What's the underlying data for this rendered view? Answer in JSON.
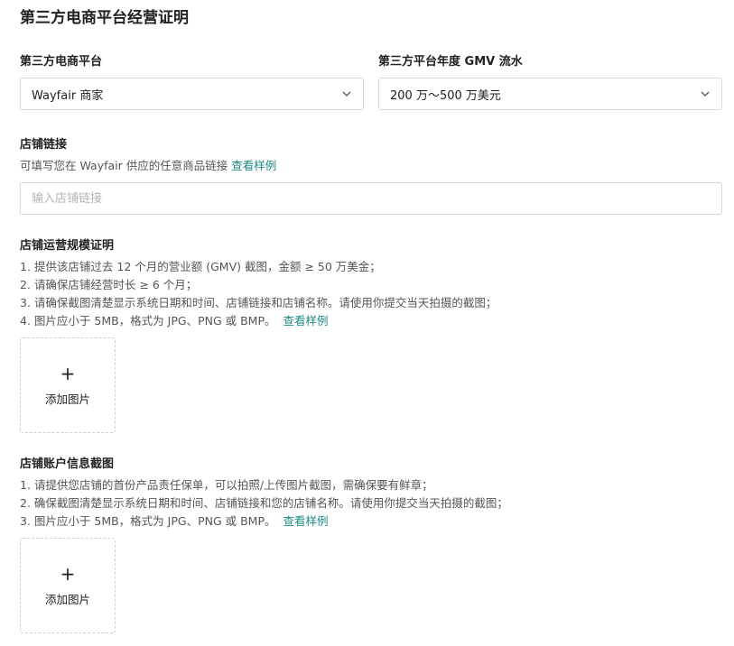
{
  "page": {
    "title": "第三方电商平台经营证明"
  },
  "platform": {
    "label": "第三方电商平台",
    "value": "Wayfair 商家",
    "icon": "chevron-down-icon"
  },
  "gmv": {
    "label": "第三方平台年度 GMV 流水",
    "value": "200 万～500 万美元",
    "icon": "chevron-down-icon"
  },
  "store_link": {
    "label": "店铺链接",
    "hint": "可填写您在 Wayfair 供应的任意商品链接",
    "sample_link": "查看样例",
    "placeholder": "输入店铺链接",
    "value": ""
  },
  "scale_proof": {
    "label": "店铺运营规模证明",
    "items": [
      "1. 提供该店铺过去 12 个月的营业额 (GMV) 截图，金额 ≥ 50 万美金；",
      "2. 请确保店铺经营时长 ≥ 6 个月；",
      "3. 请确保截图清楚显示系统日期和时间、店铺链接和店铺名称。请使用你提交当天拍摄的截图；",
      "4. 图片应小于 5MB，格式为 JPG、PNG 或 BMP。"
    ],
    "sample_link": "查看样例",
    "upload": {
      "plus": "+",
      "label": "添加图片"
    }
  },
  "account_info": {
    "label": "店铺账户信息截图",
    "items": [
      "1. 请提供您店铺的首份产品责任保单，可以拍照/上传图片截图，需确保要有鲜章；",
      "2. 确保截图清楚显示系统日期和时间、店铺链接和您的店铺名称。请使用你提交当天拍摄的截图；",
      "3. 图片应小于 5MB，格式为 JPG、PNG 或 BMP。"
    ],
    "sample_link": "查看样例",
    "upload": {
      "plus": "+",
      "label": "添加图片"
    }
  },
  "colors": {
    "link": "#1a8a84",
    "border": "#d9d9d9",
    "placeholder": "#b5b5b5"
  }
}
